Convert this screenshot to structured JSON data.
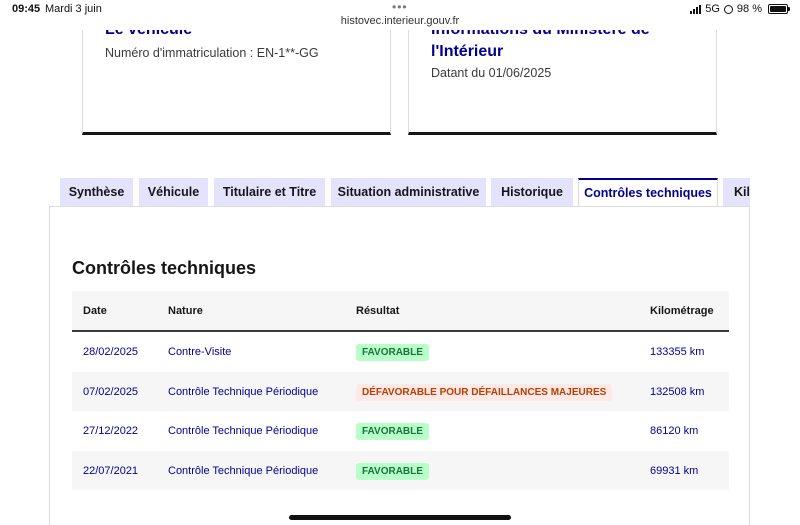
{
  "status_bar": {
    "time": "09:45",
    "date": "Mardi 3 juin",
    "url": "histovec.interieur.gouv.fr",
    "network": "5G",
    "battery": "98 %"
  },
  "cards": {
    "vehicle": {
      "title": "Le véhicule",
      "text": "Numéro d'immatriculation : EN-1**-GG"
    },
    "ministry": {
      "title": "Informations du Ministère de l'Intérieur",
      "text": "Datant du 01/06/2025"
    }
  },
  "tabs": [
    {
      "label": "Synthèse"
    },
    {
      "label": "Véhicule"
    },
    {
      "label": "Titulaire et Titre"
    },
    {
      "label": "Situation administrative"
    },
    {
      "label": "Historique"
    },
    {
      "label": "Contrôles techniques"
    },
    {
      "label": "Kilométrage"
    }
  ],
  "panel": {
    "title": "Contrôles techniques",
    "headers": {
      "date": "Date",
      "nature": "Nature",
      "result": "Résultat",
      "mileage": "Kilométrage"
    },
    "rows": [
      {
        "date": "28/02/2025",
        "nature": "Contre-Visite",
        "result": "FAVORABLE",
        "mileage": "133355 km"
      },
      {
        "date": "07/02/2025",
        "nature": "Contrôle Technique Périodique",
        "result": "DÉFAVORABLE POUR DÉFAILLANCES MAJEURES",
        "mileage": "132508 km"
      },
      {
        "date": "27/12/2022",
        "nature": "Contrôle Technique Périodique",
        "result": "FAVORABLE",
        "mileage": "86120 km"
      },
      {
        "date": "22/07/2021",
        "nature": "Contrôle Technique Périodique",
        "result": "FAVORABLE",
        "mileage": "69931 km"
      }
    ]
  },
  "colors": {
    "brand_blue": "#000091",
    "tab_bg": "#e3e3fd",
    "success_bg": "#b8fec9",
    "success_text": "#18753c",
    "error_bg": "#ffe9e6",
    "error_text": "#b34000"
  },
  "icons": [
    "signal-icon",
    "orientation-lock-icon",
    "battery-icon",
    "more-dots-icon"
  ]
}
